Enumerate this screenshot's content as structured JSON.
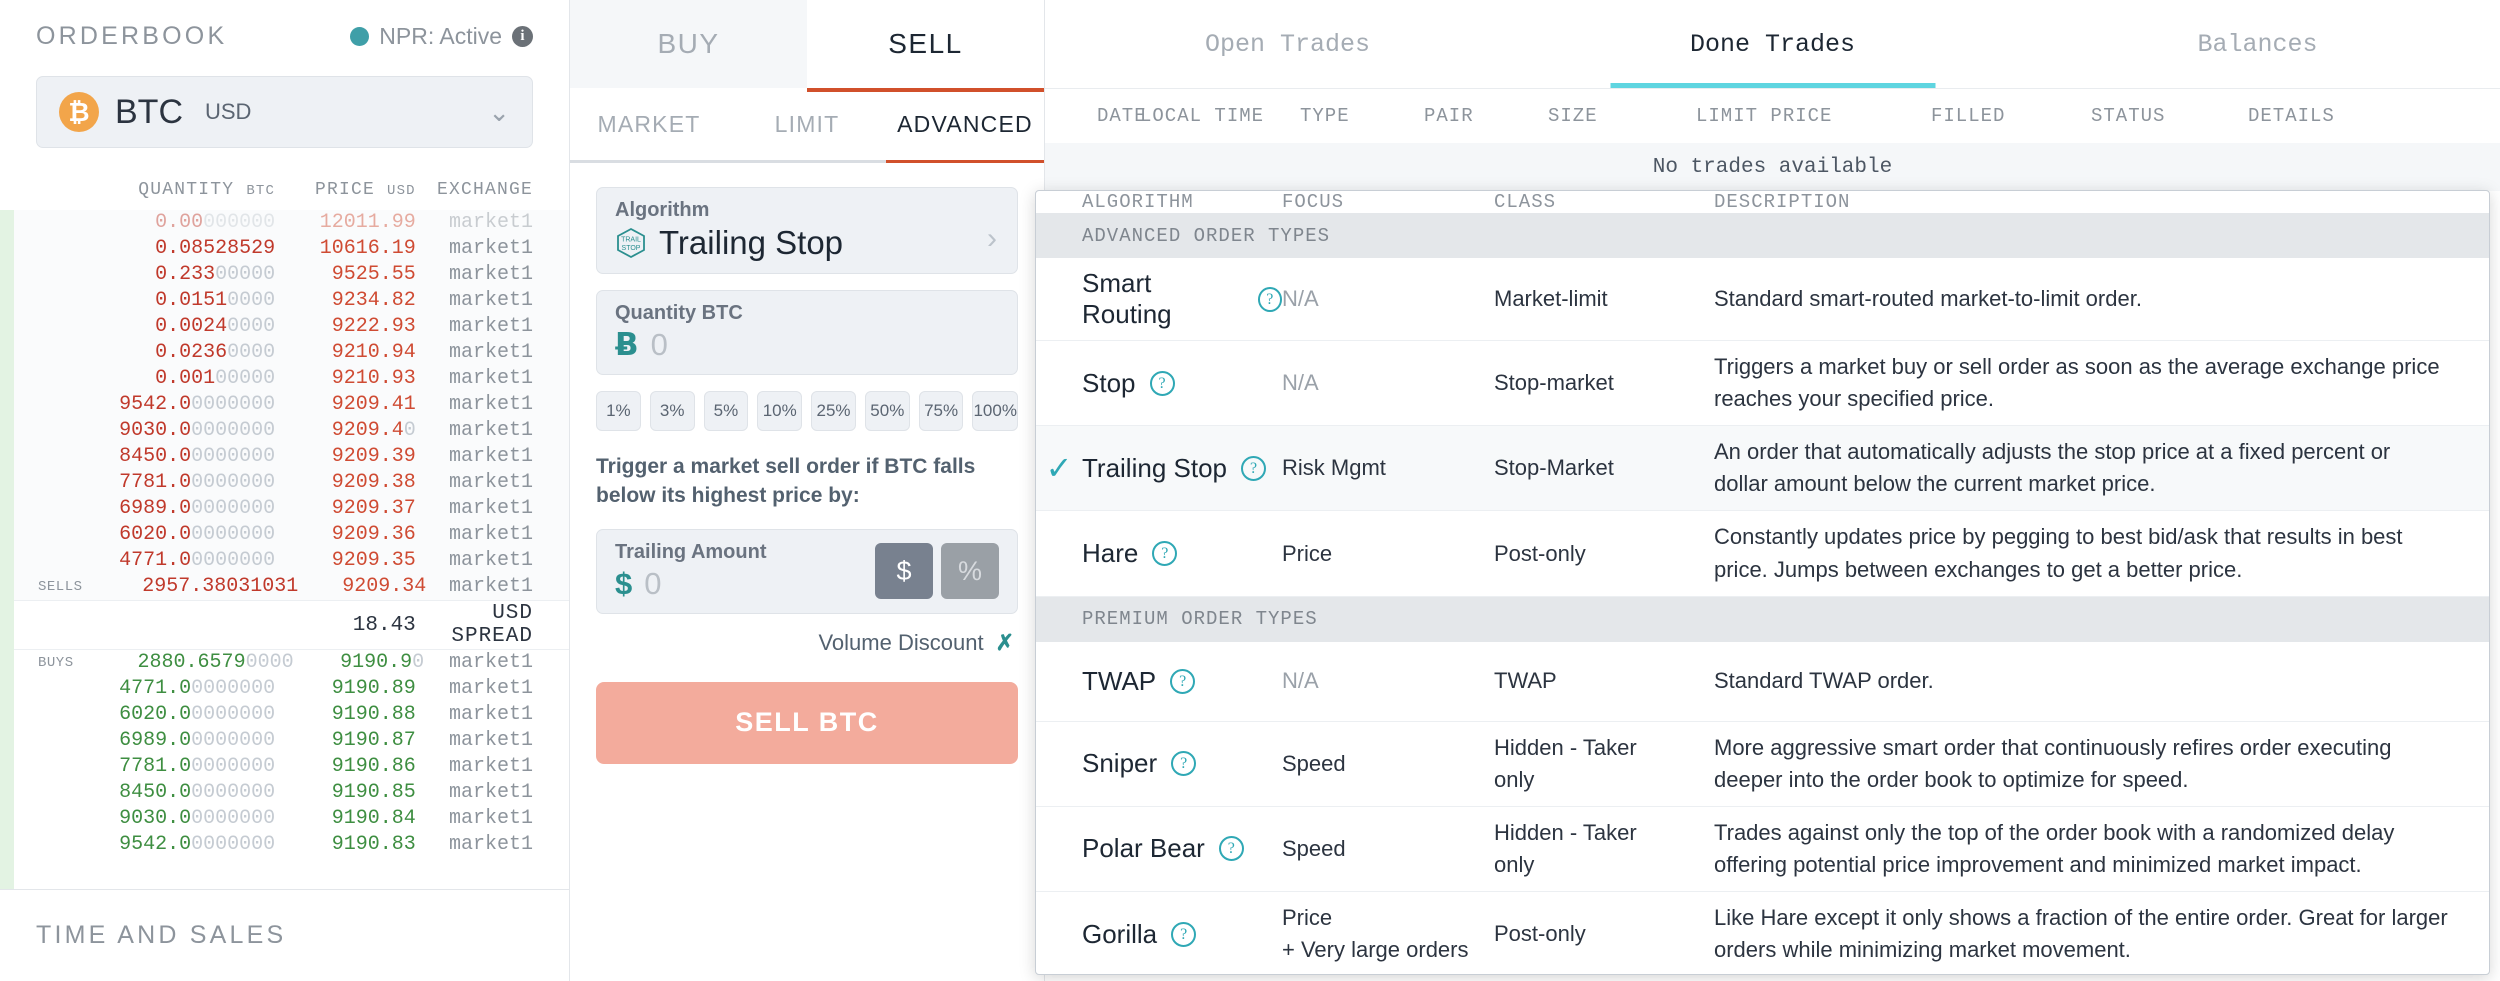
{
  "orderbook": {
    "title": "ORDERBOOK",
    "status": {
      "label": "NPR: Active",
      "dot_color": "#3f9fa8",
      "info_icon": "info-icon"
    },
    "pair": {
      "symbol": "BTC",
      "currency": "USD",
      "coin_icon": "bitcoin-icon"
    },
    "columns": {
      "quantity": "QUANTITY",
      "quantity_unit": "BTC",
      "price": "PRICE",
      "price_unit": "USD",
      "exchange": "EXCHANGE"
    },
    "sells_tag": "SELLS",
    "buys_tag": "BUYS",
    "spread": {
      "value": "18.43",
      "label": "USD SPREAD"
    },
    "sells": [
      {
        "qty_main": "0.00",
        "qty_zeros": "000000",
        "price": "12011.99",
        "price_zeros": "",
        "exchange": "market1",
        "depth": 6,
        "partial": true
      },
      {
        "qty_main": "0.08528529",
        "qty_zeros": "",
        "price": "10616.19",
        "price_zeros": "",
        "exchange": "market1",
        "depth": 6
      },
      {
        "qty_main": "0.233",
        "qty_zeros": "00000",
        "price": "9525.55",
        "price_zeros": "",
        "exchange": "market1",
        "depth": 7
      },
      {
        "qty_main": "0.0151",
        "qty_zeros": "0000",
        "price": "9234.82",
        "price_zeros": "",
        "exchange": "market1",
        "depth": 6
      },
      {
        "qty_main": "0.0024",
        "qty_zeros": "0000",
        "price": "9222.93",
        "price_zeros": "",
        "exchange": "market1",
        "depth": 6
      },
      {
        "qty_main": "0.0236",
        "qty_zeros": "0000",
        "price": "9210.94",
        "price_zeros": "",
        "exchange": "market1",
        "depth": 6
      },
      {
        "qty_main": "0.001",
        "qty_zeros": "00000",
        "price": "9210.93",
        "price_zeros": "",
        "exchange": "market1",
        "depth": 6
      },
      {
        "qty_main": "9542.0",
        "qty_zeros": "0000000",
        "price": "9209.41",
        "price_zeros": "",
        "exchange": "market1",
        "depth": 14
      },
      {
        "qty_main": "9030.0",
        "qty_zeros": "0000000",
        "price": "9209.4",
        "price_zeros": "0",
        "exchange": "market1",
        "depth": 13
      },
      {
        "qty_main": "8450.0",
        "qty_zeros": "0000000",
        "price": "9209.39",
        "price_zeros": "",
        "exchange": "market1",
        "depth": 13
      },
      {
        "qty_main": "7781.0",
        "qty_zeros": "0000000",
        "price": "9209.38",
        "price_zeros": "",
        "exchange": "market1",
        "depth": 12
      },
      {
        "qty_main": "6989.0",
        "qty_zeros": "0000000",
        "price": "9209.37",
        "price_zeros": "",
        "exchange": "market1",
        "depth": 11
      },
      {
        "qty_main": "6020.0",
        "qty_zeros": "0000000",
        "price": "9209.36",
        "price_zeros": "",
        "exchange": "market1",
        "depth": 10
      },
      {
        "qty_main": "4771.0",
        "qty_zeros": "0000000",
        "price": "9209.35",
        "price_zeros": "",
        "exchange": "market1",
        "depth": 9
      },
      {
        "qty_main": "2957.38031031",
        "qty_zeros": "",
        "price": "9209.34",
        "price_zeros": "",
        "exchange": "market1",
        "depth": 7,
        "tag": "SELLS"
      }
    ],
    "buys": [
      {
        "qty_main": "2880.6579",
        "qty_zeros": "0000",
        "price": "9190.9",
        "price_zeros": "0",
        "exchange": "market1",
        "depth": 7,
        "tag": "BUYS"
      },
      {
        "qty_main": "4771.0",
        "qty_zeros": "0000000",
        "price": "9190.89",
        "price_zeros": "",
        "exchange": "market1",
        "depth": 9
      },
      {
        "qty_main": "6020.0",
        "qty_zeros": "0000000",
        "price": "9190.88",
        "price_zeros": "",
        "exchange": "market1",
        "depth": 10
      },
      {
        "qty_main": "6989.0",
        "qty_zeros": "0000000",
        "price": "9190.87",
        "price_zeros": "",
        "exchange": "market1",
        "depth": 11
      },
      {
        "qty_main": "7781.0",
        "qty_zeros": "0000000",
        "price": "9190.86",
        "price_zeros": "",
        "exchange": "market1",
        "depth": 12
      },
      {
        "qty_main": "8450.0",
        "qty_zeros": "0000000",
        "price": "9190.85",
        "price_zeros": "",
        "exchange": "market1",
        "depth": 13
      },
      {
        "qty_main": "9030.0",
        "qty_zeros": "0000000",
        "price": "9190.84",
        "price_zeros": "",
        "exchange": "market1",
        "depth": 13
      },
      {
        "qty_main": "9542.0",
        "qty_zeros": "0000000",
        "price": "9190.83",
        "price_zeros": "",
        "exchange": "market1",
        "depth": 14
      }
    ],
    "time_and_sales_title": "TIME AND SALES"
  },
  "order_panel": {
    "side_tabs": [
      {
        "label": "BUY",
        "active": false
      },
      {
        "label": "SELL",
        "active": true
      }
    ],
    "type_tabs": [
      {
        "label": "MARKET",
        "active": false
      },
      {
        "label": "LIMIT",
        "active": false
      },
      {
        "label": "ADVANCED",
        "active": true
      }
    ],
    "algorithm_field": {
      "label": "Algorithm",
      "value": "Trailing Stop",
      "icon": "trailing-stop-icon",
      "chevron": "chevron-right-icon"
    },
    "quantity_field": {
      "label": "Quantity BTC",
      "value": "",
      "placeholder": "0",
      "symbol": "Ƀ"
    },
    "percent_buttons": [
      "1%",
      "3%",
      "5%",
      "10%",
      "25%",
      "50%",
      "75%",
      "100%"
    ],
    "trigger_text": "Trigger a market sell order if BTC falls below its highest price by:",
    "trailing_field": {
      "label": "Trailing Amount",
      "value": "",
      "placeholder": "0",
      "symbol": "$"
    },
    "unit_toggle": [
      {
        "label": "$",
        "selected": true
      },
      {
        "label": "%",
        "selected": false
      }
    ],
    "volume_discount": {
      "label": "Volume Discount",
      "chevron": "chevron-down-icon"
    },
    "submit_button": "SELL BTC"
  },
  "trades": {
    "tabs": [
      {
        "label": "Open Trades",
        "active": false
      },
      {
        "label": "Done Trades",
        "active": true
      },
      {
        "label": "Balances",
        "active": false
      }
    ],
    "columns": [
      "DATE",
      "LOCAL TIME",
      "TYPE",
      "PAIR",
      "SIZE",
      "LIMIT PRICE",
      "FILLED",
      "STATUS",
      "DETAILS"
    ],
    "empty_message": "No trades available"
  },
  "algo_modal": {
    "columns": {
      "algorithm": "ALGORITHM",
      "focus": "FOCUS",
      "class": "CLASS",
      "description": "DESCRIPTION"
    },
    "sections": [
      {
        "title": "ADVANCED ORDER TYPES",
        "rows": [
          {
            "name": "Smart Routing",
            "selected": false,
            "focus": "N/A",
            "focus_muted": true,
            "class": "Market-limit",
            "description": "Standard smart-routed market-to-limit order."
          },
          {
            "name": "Stop",
            "selected": false,
            "focus": "N/A",
            "focus_muted": true,
            "class": "Stop-market",
            "description": "Triggers a market buy or sell order as soon as the average exchange price reaches your specified price."
          },
          {
            "name": "Trailing Stop",
            "selected": true,
            "focus": "Risk Mgmt",
            "focus_muted": false,
            "class": "Stop-Market",
            "description": "An order that automatically adjusts the stop price at a fixed percent or dollar amount below the current market price."
          },
          {
            "name": "Hare",
            "selected": false,
            "focus": "Price",
            "focus_muted": false,
            "class": "Post-only",
            "description": "Constantly updates price by pegging to best bid/ask that results in best price. Jumps between exchanges to get a better price."
          }
        ]
      },
      {
        "title": "PREMIUM ORDER TYPES",
        "rows": [
          {
            "name": "TWAP",
            "selected": false,
            "focus": "N/A",
            "focus_muted": true,
            "class": "TWAP",
            "description": "Standard TWAP order."
          },
          {
            "name": "Sniper",
            "selected": false,
            "focus": "Speed",
            "focus_muted": false,
            "class": "Hidden - Taker only",
            "description": "More aggressive smart order that continuously refires order executing deeper into the order book to optimize for speed."
          },
          {
            "name": "Polar Bear",
            "selected": false,
            "focus": "Speed",
            "focus_muted": false,
            "class": "Hidden - Taker only",
            "description": "Trades against only the top of the order book with a randomized delay offering potential price improvement and minimized market impact."
          },
          {
            "name": "Gorilla",
            "selected": false,
            "focus": "Price\n+ Very large orders",
            "focus_muted": false,
            "class": "Post-only",
            "description": "Like Hare except it only shows a fraction of the entire order. Great for larger orders while minimizing market movement."
          }
        ]
      }
    ],
    "help_icon": "question-mark-icon",
    "check_icon": "check-icon"
  }
}
